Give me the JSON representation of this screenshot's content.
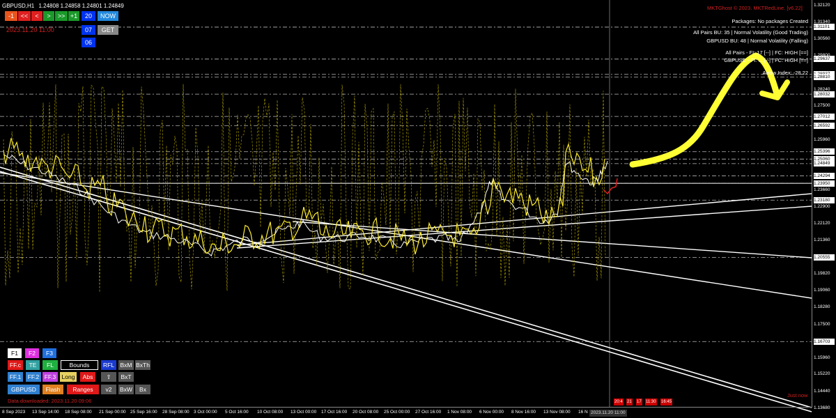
{
  "chart_header": {
    "symbol_tf": "GBPUSD,H1",
    "ohlc": "1.24808 1.24858 1.24801 1.24849",
    "date_red": "2023.11.20 11:00",
    "copyright": "MKTGhost © 2023. MKTRedLine. [v6.22]"
  },
  "nav_buttons": [
    {
      "label": "-1",
      "bg": "#e8541c"
    },
    {
      "label": "<<",
      "bg": "#e02020"
    },
    {
      "label": "<",
      "bg": "#e02020"
    },
    {
      "label": ">",
      "bg": "#1a9a2a"
    },
    {
      "label": ">>",
      "bg": "#1a9a2a"
    },
    {
      "label": "+1",
      "bg": "#1a9a2a"
    },
    {
      "label": "20",
      "bg": "#0033ee"
    },
    {
      "label": "NOW",
      "bg": "#2288dd"
    },
    {
      "label": "07",
      "bg": "#0033ee"
    },
    {
      "label": "GET",
      "bg": "#888888"
    },
    {
      "label": "06",
      "bg": "#0033ee"
    }
  ],
  "info_panel": {
    "packages": "Packages: No packages Created",
    "line1": "All Pairs BU: 35 | Normal Volatility (Good Trading)",
    "line2": "GBPUSD BU: 48 | Normal Volatility (Falling)",
    "line3": "All Pairs - FI: 17 [--] | FC: HIGH [==]",
    "line4": "GBPUSD - FI: ... [--] | FC: HIGH [==]",
    "line5": "Arrow Index: -28.22"
  },
  "price_labels": [
    {
      "value": "1.32120",
      "boxed": false
    },
    {
      "value": "1.31340",
      "boxed": false
    },
    {
      "value": "1.31101",
      "boxed": true
    },
    {
      "value": "1.30560",
      "boxed": false
    },
    {
      "value": "1.29800",
      "boxed": false
    },
    {
      "value": "1.29637",
      "boxed": true
    },
    {
      "value": "1.28937",
      "boxed": true
    },
    {
      "value": "1.28810",
      "boxed": true
    },
    {
      "value": "1.28240",
      "boxed": false
    },
    {
      "value": "1.28032",
      "boxed": true
    },
    {
      "value": "1.27500",
      "boxed": false
    },
    {
      "value": "1.27012",
      "boxed": true
    },
    {
      "value": "1.26592",
      "boxed": true
    },
    {
      "value": "1.25960",
      "boxed": false
    },
    {
      "value": "1.25396",
      "boxed": true
    },
    {
      "value": "1.25060",
      "boxed": true
    },
    {
      "value": "1.24849",
      "boxed": true
    },
    {
      "value": "1.24294",
      "boxed": true
    },
    {
      "value": "1.23950",
      "boxed": true
    },
    {
      "value": "1.23660",
      "boxed": false
    },
    {
      "value": "1.23180",
      "boxed": true
    },
    {
      "value": "1.22900",
      "boxed": false
    },
    {
      "value": "1.22120",
      "boxed": false
    },
    {
      "value": "1.21360",
      "boxed": false
    },
    {
      "value": "1.20555",
      "boxed": true
    },
    {
      "value": "1.19820",
      "boxed": false
    },
    {
      "value": "1.19060",
      "boxed": false
    },
    {
      "value": "1.18280",
      "boxed": false
    },
    {
      "value": "1.17500",
      "boxed": false
    },
    {
      "value": "1.16703",
      "boxed": true
    },
    {
      "value": "1.15960",
      "boxed": false
    },
    {
      "value": "1.15220",
      "boxed": false
    },
    {
      "value": "1.14440",
      "boxed": false
    },
    {
      "value": "1.13680",
      "boxed": false
    }
  ],
  "x_labels": [
    "8 Sep 2023",
    "13 Sep 14:00",
    "18 Sep 08:00",
    "21 Sep 00:00",
    "25 Sep 16:00",
    "28 Sep 08:00",
    "3 Oct 00:00",
    "5 Oct 16:00",
    "10 Oct 08:00",
    "13 Oct 00:00",
    "17 Oct 16:00",
    "20 Oct 08:00",
    "25 Oct 00:00",
    "27 Oct 16:00",
    "1 Nov 08:00",
    "6 Nov 00:00",
    "8 Nov 16:00",
    "13 Nov 08:00",
    "16 N"
  ],
  "time_label": "2023.11.20 11:00",
  "time_boxes": [
    "20:4",
    "21",
    "17",
    "11:30",
    "16:45"
  ],
  "just_now": "Just now",
  "panel_rows": [
    [
      {
        "label": "F1",
        "bg": "#ffffff",
        "fg": "#000000",
        "bd": "#ffffff"
      },
      {
        "label": "F2",
        "bg": "#e030e0",
        "fg": "#ffffff",
        "bd": "#e030e0"
      },
      {
        "label": "F3",
        "bg": "#2070e0",
        "fg": "#ffffff",
        "bd": "#2070e0"
      }
    ],
    [
      {
        "label": "FF.c",
        "bg": "#e01818",
        "fg": "#ffffff",
        "bd": "#e01818"
      },
      {
        "label": "TE",
        "bg": "#30a0a0",
        "fg": "#ffffff",
        "bd": "#30a0a0"
      },
      {
        "label": "FL",
        "bg": "#20b040",
        "fg": "#ffffff",
        "bd": "#20b040"
      },
      {
        "label": "Bounds",
        "bg": "#000000",
        "fg": "#ffffff",
        "bd": "#ffffff"
      },
      {
        "label": "RFL",
        "bg": "#1a3ad0",
        "fg": "#ffffff",
        "bd": "#1a3ad0"
      },
      {
        "label": "BxM",
        "bg": "#555555",
        "fg": "#ffffff",
        "bd": "#555555"
      },
      {
        "label": "BxTh",
        "bg": "#555555",
        "fg": "#ffffff",
        "bd": "#555555"
      }
    ],
    [
      {
        "label": "FF.1",
        "bg": "#3080d0",
        "fg": "#ffffff",
        "bd": "#3080d0"
      },
      {
        "label": "FF.2",
        "bg": "#3080d0",
        "fg": "#ffffff",
        "bd": "#3080d0"
      },
      {
        "label": "FF.3",
        "bg": "#c040e0",
        "fg": "#ffffff",
        "bd": "#c040e0"
      },
      {
        "label": "Long",
        "bg": "#e8d060",
        "fg": "#000000",
        "bd": "#e8d060"
      },
      {
        "label": "Abs",
        "bg": "#e01818",
        "fg": "#ffffff",
        "bd": "#e01818"
      },
      {
        "label": "⇧",
        "bg": "#555555",
        "fg": "#ffffff",
        "bd": "#555555"
      },
      {
        "label": "BxT",
        "bg": "#555555",
        "fg": "#ffffff",
        "bd": "#555555"
      }
    ],
    [
      {
        "label": "GBPUSD",
        "bg": "#3080d0",
        "fg": "#ffffff",
        "bd": "#3080d0"
      },
      {
        "label": "Flash",
        "bg": "#e08020",
        "fg": "#ffffff",
        "bd": "#e08020"
      },
      {
        "label": "Ranges",
        "bg": "#e01818",
        "fg": "#ffffff",
        "bd": "#e01818"
      },
      {
        "label": "v2",
        "bg": "#555555",
        "fg": "#ffffff",
        "bd": "#555555"
      },
      {
        "label": "BxW",
        "bg": "#555555",
        "fg": "#ffffff",
        "bd": "#555555"
      },
      {
        "label": "Bx",
        "bg": "#555555",
        "fg": "#ffffff",
        "bd": "#555555"
      }
    ]
  ],
  "data_downloaded": "Data downloaded: 2023.11.20 09:06",
  "colors": {
    "price_line": "#ffffff",
    "indicator": "#ffee33",
    "accent_red": "#e01818",
    "background": "#000000"
  }
}
